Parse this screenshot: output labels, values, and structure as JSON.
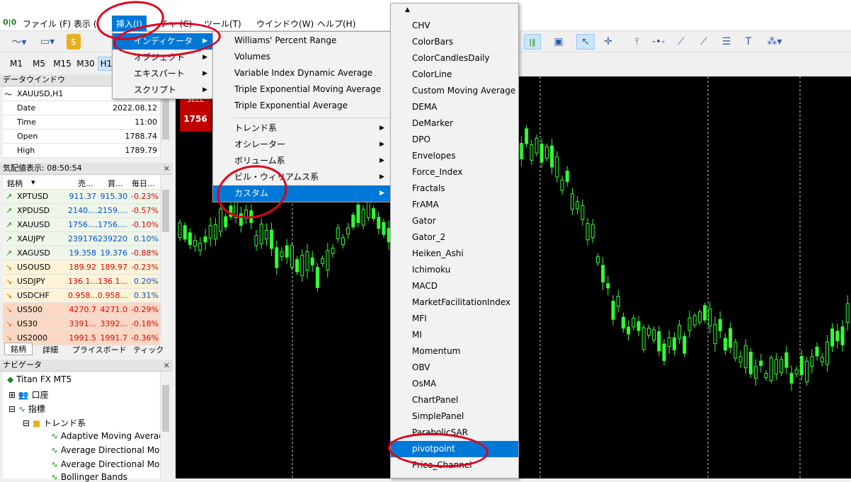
{
  "menubar": {
    "items": [
      "ファイル (F)",
      "表示 (",
      "挿入(I)",
      "チャ (C)",
      "ツール(T)",
      "ウインドウ(W)",
      "ヘルプ(H)"
    ]
  },
  "timeframes": [
    "M1",
    "M5",
    "M15",
    "M30",
    "H1"
  ],
  "data_window": {
    "title": "データウインドウ",
    "symbol": "XAUUSD,H1",
    "rows": [
      {
        "k": "Date",
        "v": "2022.08.12"
      },
      {
        "k": "Time",
        "v": "11:00"
      },
      {
        "k": "Open",
        "v": "1788.74"
      },
      {
        "k": "High",
        "v": "1789.79"
      }
    ]
  },
  "quotes": {
    "title": "気配値表示: 08:50:54",
    "headers": [
      "銘柄",
      "売...",
      "買...",
      "毎日..."
    ],
    "rows": [
      {
        "s": "XPTUSD",
        "b": "911.37",
        "a": "915.30",
        "c": "-0.23%",
        "dir": "up"
      },
      {
        "s": "XPDUSD",
        "b": "2140....",
        "a": "2159....",
        "c": "-0.57%",
        "dir": "up"
      },
      {
        "s": "XAUUSD",
        "b": "1756....",
        "a": "1756....",
        "c": "-0.10%",
        "dir": "up"
      },
      {
        "s": "XAUJPY",
        "b": "239176",
        "a": "239220",
        "c": "0.10%",
        "dir": "up"
      },
      {
        "s": "XAGUSD",
        "b": "19.358",
        "a": "19.376",
        "c": "-0.88%",
        "dir": "up"
      },
      {
        "s": "USOUSD",
        "b": "189.92",
        "a": "189.97",
        "c": "-0.23%",
        "dir": "down"
      },
      {
        "s": "USDJPY",
        "b": "136.1...",
        "a": "136.1...",
        "c": "0.20%",
        "dir": "down"
      },
      {
        "s": "USDCHF",
        "b": "0.958...",
        "a": "0.958...",
        "c": "0.31%",
        "dir": "down"
      },
      {
        "s": "US500",
        "b": "4270.7",
        "a": "4271.0",
        "c": "-0.29%",
        "dir": "down"
      },
      {
        "s": "US30",
        "b": "3391...",
        "a": "3392...",
        "c": "-0.18%",
        "dir": "down"
      },
      {
        "s": "US2000",
        "b": "1991.5",
        "a": "1991.7",
        "c": "-0.36%",
        "dir": "down"
      }
    ],
    "tabs": [
      "銘柄",
      "詳細",
      "プライスボード",
      "ティック"
    ]
  },
  "navigator": {
    "title": "ナビゲータ",
    "items": [
      "Titan FX MT5",
      "口座",
      "指標",
      "トレンド系",
      "Adaptive Moving Averag",
      "Average Directional Move",
      "Average Directional Move",
      "Bollinger Bands"
    ]
  },
  "sell": {
    "label": "SELL",
    "price": "1756"
  },
  "insert_menu": {
    "items": [
      "インディケータ",
      "オブジェクト",
      "エキスパート",
      "スクリプト"
    ]
  },
  "indicator_menu": {
    "recent": [
      "Williams' Percent Range",
      "Volumes",
      "Variable Index Dynamic Average",
      "Triple Exponential Moving Average",
      "Triple Exponential Average"
    ],
    "groups": [
      "トレンド系",
      "オシレーター",
      "ボリューム系",
      "ビル・ウィリアムス系",
      "カスタム"
    ]
  },
  "custom_menu": {
    "items": [
      "CHV",
      "ColorBars",
      "ColorCandlesDaily",
      "ColorLine",
      "Custom Moving Average",
      "DEMA",
      "DeMarker",
      "DPO",
      "Envelopes",
      "Force_Index",
      "Fractals",
      "FrAMA",
      "Gator",
      "Gator_2",
      "Heiken_Ashi",
      "Ichimoku",
      "MACD",
      "MarketFacilitationIndex",
      "MFI",
      "MI",
      "Momentum",
      "OBV",
      "OsMA",
      "ChartPanel",
      "SimplePanel",
      "ParabolicSAR",
      "pivotpoint",
      "Price_Channel"
    ]
  },
  "colors": {
    "up": "#0050c8",
    "down": "#e00000",
    "candle": "#33ff33",
    "accent": "#0078d7",
    "annotation": "#e0001a"
  }
}
